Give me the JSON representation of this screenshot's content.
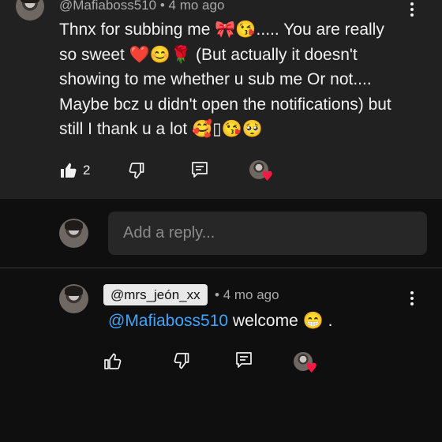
{
  "comment": {
    "author": "@Mafiaboss510",
    "time": "4 mo ago",
    "separator": "•",
    "lines": [
      "Thnx for subbing me  🎀😘..... You are really",
      "so sweet ❤️😊🌹  (But actually it doesn't",
      "showing to me whether u sub me Or not....",
      "Maybe bcz u didn't open the notifications) but",
      "still I thank u a lot 🥰▯😘🥺"
    ],
    "like_count": "2",
    "icons": {
      "like": "thumbs-up-filled-icon",
      "dislike": "thumbs-down-icon",
      "reply": "reply-comment-icon",
      "creator_heart": "creator-heart-icon",
      "menu": "more-vertical-icon"
    }
  },
  "reply_input": {
    "placeholder": "Add a reply..."
  },
  "reply": {
    "author": "@mrs_jeón_xx",
    "separator": "•",
    "time": "4 mo ago",
    "mention": "@Mafiaboss510",
    "text": "welcome 😁 ."
  },
  "colors": {
    "background": "#0f0f0f",
    "comment_background": "#212121",
    "mention": "#3ea6ff",
    "heart": "#ff1744"
  }
}
